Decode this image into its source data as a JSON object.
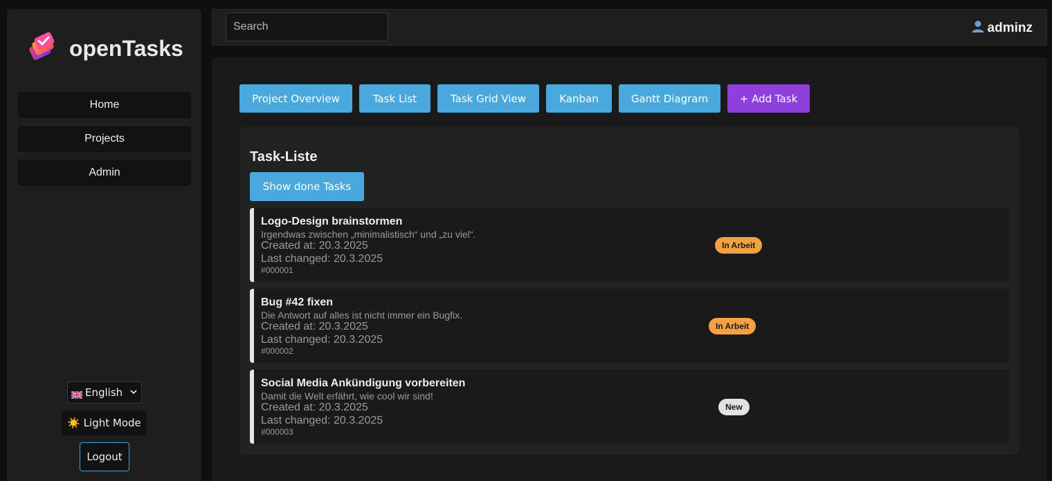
{
  "app": {
    "name": "openTasks"
  },
  "sidebar": {
    "items": [
      {
        "label": "Home"
      },
      {
        "label": "Projects"
      },
      {
        "label": "Admin"
      }
    ],
    "language": {
      "selected": "English"
    },
    "mode_label": "☀️ Light Mode",
    "logout_label": "Logout"
  },
  "header": {
    "search_placeholder": "Search",
    "username": "adminz"
  },
  "views": {
    "project_overview": "Project Overview",
    "task_list": "Task List",
    "task_grid": "Task Grid View",
    "kanban": "Kanban",
    "gantt": "Gantt Diagram",
    "add_task": "+ Add Task"
  },
  "panel": {
    "title": "Task-Liste",
    "show_done": "Show done Tasks"
  },
  "tasks": [
    {
      "title": "Logo-Design brainstormen",
      "description": "Irgendwas zwischen „minimalistisch“ und „zu viel“.",
      "created": "Created at: 20.3.2025",
      "changed": "Last changed: 20.3.2025",
      "id": "#000001",
      "status": "In Arbeit"
    },
    {
      "title": "Bug #42 fixen",
      "description": "Die Antwort auf alles ist nicht immer ein Bugfix.",
      "created": "Created at: 20.3.2025",
      "changed": "Last changed: 20.3.2025",
      "id": "#000002",
      "status": "In Arbeit"
    },
    {
      "title": "Social Media Ankündigung vorbereiten",
      "description": "Damit die Welt erfährt, wie cool wir sind!",
      "created": "Created at: 20.3.2025",
      "changed": "Last changed: 20.3.2025",
      "id": "#000003",
      "status": "New"
    }
  ],
  "colors": {
    "primary": "#4aa8dc",
    "accent": "#8e3fdc",
    "status_in_progress": "#f5a041",
    "status_new": "#e2e2e2"
  }
}
